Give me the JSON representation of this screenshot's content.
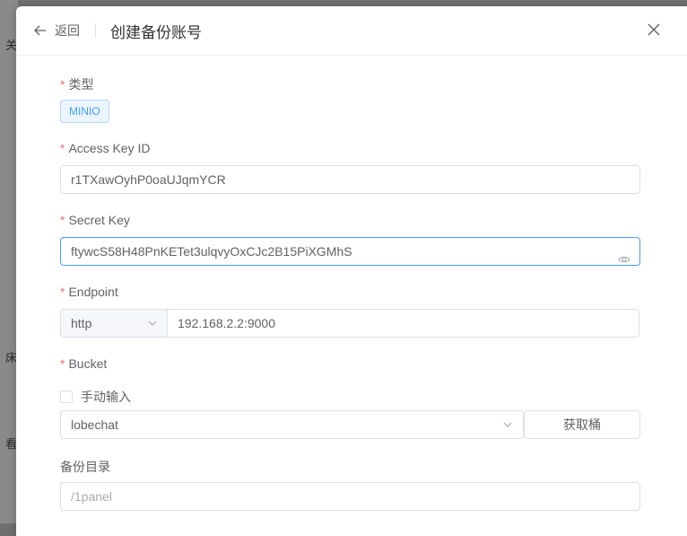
{
  "background": {
    "fragments": [
      "关",
      "床配",
      "看"
    ]
  },
  "header": {
    "back_label": "返回",
    "title": "创建备份账号"
  },
  "form": {
    "type": {
      "label": "类型",
      "required": "*",
      "value": "MINIO"
    },
    "access_key": {
      "label": "Access Key ID",
      "required": "*",
      "value": "r1TXawOyhP0oaUJqmYCR"
    },
    "secret_key": {
      "label": "Secret Key",
      "required": "*",
      "value": "ftywcS58H48PnKETet3ulqvyOxCJc2B15PiXGMhS"
    },
    "endpoint": {
      "label": "Endpoint",
      "required": "*",
      "protocol": "http",
      "value": "192.168.2.2:9000"
    },
    "bucket": {
      "label": "Bucket",
      "required": "*",
      "manual_input_label": "手动输入",
      "manual_checked": false,
      "value": "lobechat",
      "fetch_button": "获取桶"
    },
    "backup_dir": {
      "label": "备份目录",
      "placeholder": "/1panel"
    }
  },
  "colors": {
    "accent": "#409eff",
    "required": "#f56c6c",
    "border": "#dcdfe6"
  }
}
